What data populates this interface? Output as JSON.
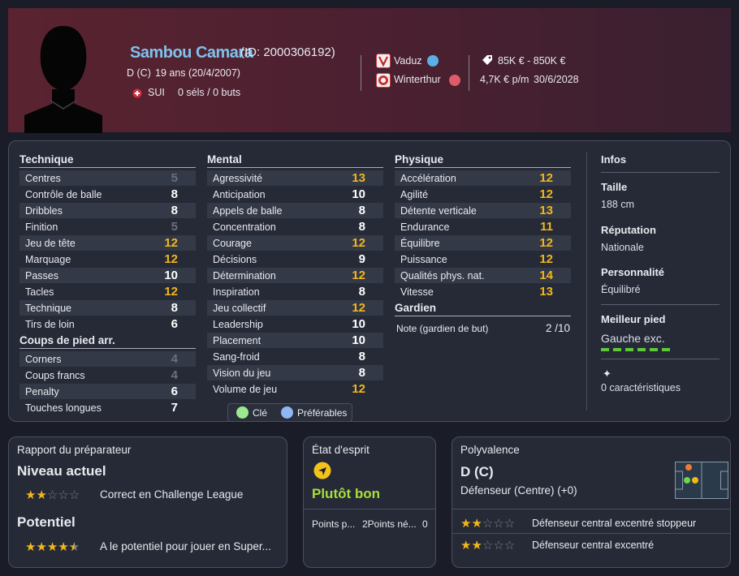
{
  "player": {
    "name": "Sambou Camara",
    "id": "(ID: 2000306192)",
    "position": "D (C)",
    "age": "19 ans (20/4/2007)",
    "nation": "SUI",
    "caps": "0 séls / 0 buts"
  },
  "clubs": {
    "current": "Vaduz",
    "parent": "Winterthur"
  },
  "contract": {
    "value": "85K € - 850K €",
    "wage": "4,7K € p/m",
    "expiry": "30/6/2028"
  },
  "technique": {
    "title": "Technique",
    "rows": [
      [
        "Centres",
        "5"
      ],
      [
        "Contrôle de balle",
        "8"
      ],
      [
        "Dribbles",
        "8"
      ],
      [
        "Finition",
        "5"
      ],
      [
        "Jeu de tête",
        "12"
      ],
      [
        "Marquage",
        "12"
      ],
      [
        "Passes",
        "10"
      ],
      [
        "Tacles",
        "12"
      ],
      [
        "Technique",
        "8"
      ],
      [
        "Tirs de loin",
        "6"
      ]
    ]
  },
  "set_pieces": {
    "title": "Coups de pied arr.",
    "rows": [
      [
        "Corners",
        "4"
      ],
      [
        "Coups francs",
        "4"
      ],
      [
        "Penalty",
        "6"
      ],
      [
        "Touches longues",
        "7"
      ]
    ]
  },
  "mental": {
    "title": "Mental",
    "rows": [
      [
        "Agressivité",
        "13"
      ],
      [
        "Anticipation",
        "10"
      ],
      [
        "Appels de balle",
        "8"
      ],
      [
        "Concentration",
        "8"
      ],
      [
        "Courage",
        "12"
      ],
      [
        "Décisions",
        "9"
      ],
      [
        "Détermination",
        "12"
      ],
      [
        "Inspiration",
        "8"
      ],
      [
        "Jeu collectif",
        "12"
      ],
      [
        "Leadership",
        "10"
      ],
      [
        "Placement",
        "10"
      ],
      [
        "Sang-froid",
        "8"
      ],
      [
        "Vision du jeu",
        "8"
      ],
      [
        "Volume de jeu",
        "12"
      ]
    ]
  },
  "physique": {
    "title": "Physique",
    "rows": [
      [
        "Accélération",
        "12"
      ],
      [
        "Agilité",
        "12"
      ],
      [
        "Détente verticale",
        "13"
      ],
      [
        "Endurance",
        "11"
      ],
      [
        "Équilibre",
        "12"
      ],
      [
        "Puissance",
        "12"
      ],
      [
        "Qualités phys. nat.",
        "14"
      ],
      [
        "Vitesse",
        "13"
      ]
    ]
  },
  "gardien": {
    "title": "Gardien",
    "label": "Note (gardien de but)",
    "value": "2 /10"
  },
  "infos": {
    "title": "Infos",
    "taille_t": "Taille",
    "taille_v": "188 cm",
    "rep_t": "Réputation",
    "rep_v": "Nationale",
    "perso_t": "Personnalité",
    "perso_v": "Équilibré",
    "pied_t": "Meilleur pied",
    "pied_v": "Gauche exc.",
    "carac": "0 caractéristiques"
  },
  "legend": {
    "key": "Clé",
    "pref": "Préférables"
  },
  "rapport": {
    "title": "Rapport du préparateur",
    "niveau_t": "Niveau actuel",
    "niveau_stars": 2,
    "niveau_text": "Correct en Challenge League",
    "pot_t": "Potentiel",
    "pot_stars": 4.5,
    "pot_text": "A le potentiel pour jouer en Super..."
  },
  "esprit": {
    "title": "État d'esprit",
    "value": "Plutôt bon",
    "points1": "Points p...",
    "points2": "2Points né...",
    "points3": "0"
  },
  "poly": {
    "title": "Polyvalence",
    "pos": "D (C)",
    "desc": "Défenseur (Centre) (+0)",
    "role1": "Défenseur central excentré stoppeur",
    "role1_stars": 2,
    "role2": "Défenseur central excentré",
    "role2_stars": 2
  },
  "colors": {
    "accent_gold": "#f3b71b",
    "name_blue": "#7ec3ec",
    "good_green": "#a8dd3a",
    "key_green": "#9be88f",
    "pref_blue": "#8fb6f5"
  }
}
